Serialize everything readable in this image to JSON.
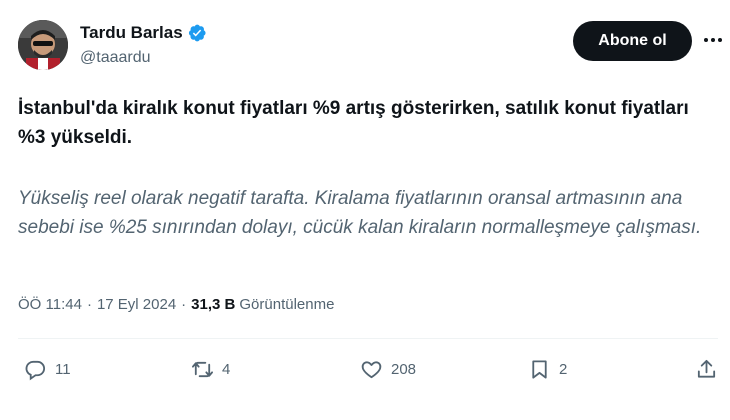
{
  "author": {
    "name": "Tardu Barlas",
    "handle": "@taaardu"
  },
  "follow_button_label": "Abone ol",
  "tweet": {
    "text_main": "İstanbul'da kiralık konut fiyatları %9 artış gösterirken, satılık konut fiyatları %3 yükseldi.",
    "text_note": "Yükseliş reel olarak negatif tarafta. Kiralama fiyatlarının oransal artmasının ana sebebi ise %25 sınırından dolayı, cücük kalan kiraların normalleşmeye çalışması."
  },
  "meta": {
    "time": "ÖÖ 11:44",
    "separator": "·",
    "date": "17 Eyl 2024",
    "views_count": "31,3 B",
    "views_label": "Görüntülenme"
  },
  "actions": {
    "replies": "11",
    "reposts": "4",
    "likes": "208",
    "bookmarks": "2"
  },
  "colors": {
    "text": "#0f1419",
    "secondary": "#536471",
    "verified": "#1d9bf0",
    "button_bg": "#0f1419"
  },
  "icons": [
    "verified-badge-icon",
    "more-icon",
    "reply-icon",
    "repost-icon",
    "like-icon",
    "bookmark-icon",
    "share-icon"
  ]
}
